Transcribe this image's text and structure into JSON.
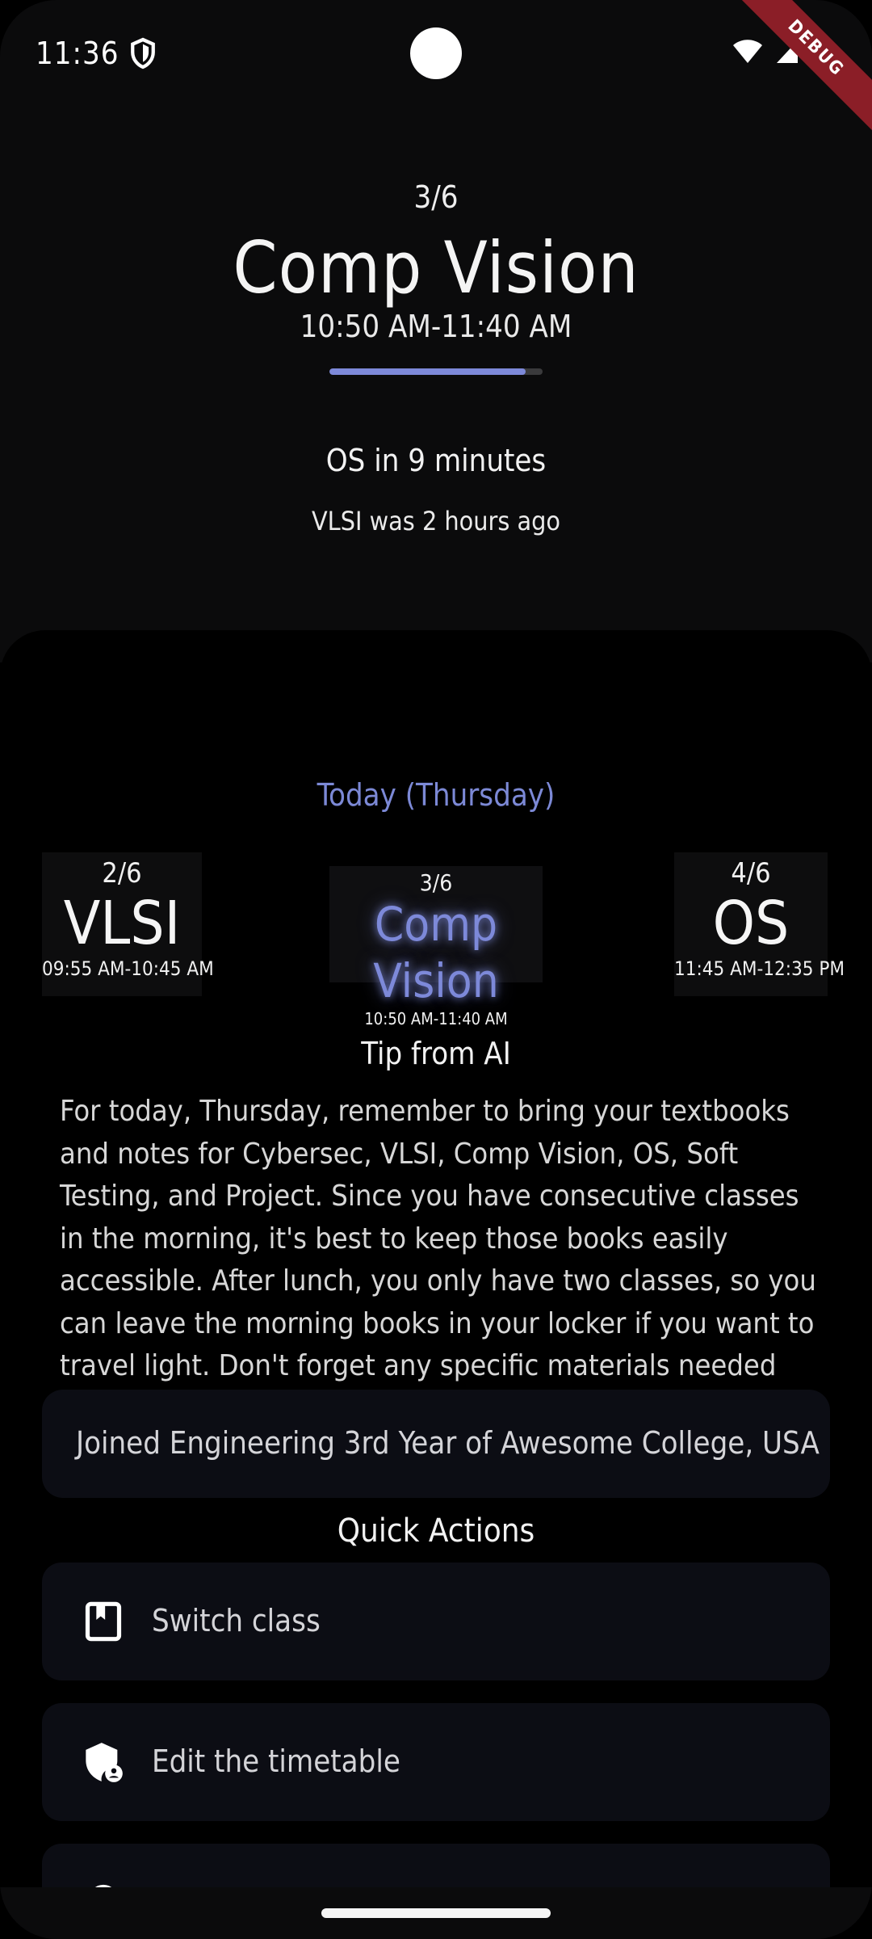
{
  "status": {
    "time": "11:36",
    "debug_label": "DEBUG"
  },
  "current": {
    "index": "3/6",
    "title": "Comp Vision",
    "time": "10:50 AM-11:40 AM",
    "progress": 0.92,
    "next_text": "OS in 9 minutes",
    "prev_text": "VLSI was 2 hours ago"
  },
  "today": {
    "label": "Today (Thursday)",
    "prev": {
      "index": "2/6",
      "title": "VLSI",
      "time": "09:55 AM-10:45 AM"
    },
    "current": {
      "index": "3/6",
      "title": "Comp Vision",
      "time": "10:50 AM-11:40 AM"
    },
    "next": {
      "index": "4/6",
      "title": "OS",
      "time": "11:45 AM-12:35 PM"
    }
  },
  "tip": {
    "title": "Tip from AI",
    "body": "For today, Thursday, remember to bring your textbooks and notes for Cybersec, VLSI, Comp Vision, OS, Soft Testing, and Project. Since you have consecutive classes in the morning, it's best to keep those books easily accessible. After lunch, you only have two classes, so you can leave the morning books in your locker if you want to travel light. Don't forget any specific materials needed for your Project session in the afternoon."
  },
  "joined": "Joined Engineering 3rd Year of Awesome College, USA",
  "quick_actions": {
    "title": "Quick Actions",
    "items": [
      {
        "label": "Switch class",
        "icon": "bookmark-book-icon"
      },
      {
        "label": "Edit the timetable",
        "icon": "admin-shield-icon"
      },
      {
        "label": "",
        "icon": "unknown-icon"
      }
    ]
  },
  "colors": {
    "accent": "#7d89d9",
    "card_bg": "#0c0d14",
    "top_bg": "#0b0b0c",
    "debug": "#8b1e27"
  }
}
